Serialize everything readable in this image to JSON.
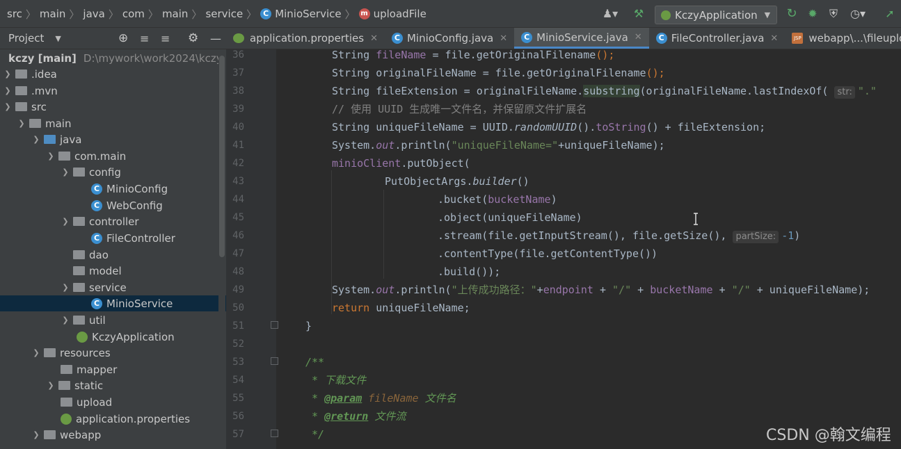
{
  "breadcrumb": {
    "items": [
      "src",
      "main",
      "java",
      "com",
      "main",
      "service"
    ],
    "class_name": "MinioService",
    "method_name": "uploadFile"
  },
  "toolbar": {
    "run_config": "KczyApplication"
  },
  "project_panel": {
    "title": "Project",
    "tree": [
      {
        "label": "kczy [main]",
        "extra": "D:\\mywork\\work2024\\kczy",
        "type": "module",
        "expanded": true
      },
      {
        "label": ".idea",
        "type": "folder",
        "expanded": false
      },
      {
        "label": ".mvn",
        "type": "folder",
        "expanded": false
      },
      {
        "label": "src",
        "type": "folder",
        "expanded": true
      },
      {
        "label": "main",
        "type": "folder",
        "expanded": true
      },
      {
        "label": "java",
        "type": "source-folder",
        "expanded": true
      },
      {
        "label": "com.main",
        "type": "package",
        "expanded": true
      },
      {
        "label": "config",
        "type": "package",
        "expanded": true
      },
      {
        "label": "MinioConfig",
        "type": "class"
      },
      {
        "label": "WebConfig",
        "type": "class"
      },
      {
        "label": "controller",
        "type": "package",
        "expanded": true
      },
      {
        "label": "FileController",
        "type": "class"
      },
      {
        "label": "dao",
        "type": "package"
      },
      {
        "label": "model",
        "type": "package"
      },
      {
        "label": "service",
        "type": "package",
        "expanded": true
      },
      {
        "label": "MinioService",
        "type": "class",
        "selected": true
      },
      {
        "label": "util",
        "type": "package",
        "expanded": false
      },
      {
        "label": "KczyApplication",
        "type": "spring-class"
      },
      {
        "label": "resources",
        "type": "resources-folder",
        "expanded": true
      },
      {
        "label": "mapper",
        "type": "folder"
      },
      {
        "label": "static",
        "type": "folder",
        "expanded": false
      },
      {
        "label": "upload",
        "type": "folder"
      },
      {
        "label": "application.properties",
        "type": "properties"
      },
      {
        "label": "webapp",
        "type": "web-folder",
        "expanded": true
      }
    ]
  },
  "tabs": [
    {
      "label": "application.properties",
      "icon": "properties-icon",
      "active": false
    },
    {
      "label": "MinioConfig.java",
      "icon": "class-icon",
      "active": false
    },
    {
      "label": "MinioService.java",
      "icon": "class-icon",
      "active": true
    },
    {
      "label": "FileController.java",
      "icon": "class-icon",
      "active": false
    },
    {
      "label": "webapp\\...\\fileupload.jsp",
      "icon": "jsp-icon",
      "active": false
    }
  ],
  "line_numbers": [
    "36",
    "37",
    "38",
    "39",
    "40",
    "41",
    "42",
    "43",
    "44",
    "45",
    "46",
    "47",
    "48",
    "49",
    "50",
    "51",
    "52",
    "53",
    "54",
    "55",
    "56",
    "57"
  ],
  "code": {
    "l36": {
      "type": "String ",
      "var": "fileName",
      "rest1": " = file.",
      "call": "getOriginalFilename",
      "rest2": "();"
    },
    "l37": {
      "type": "String originalFileName = file.",
      "call": "getOriginalFilename",
      "rest2": "();"
    },
    "l38": {
      "pre": "String fileExtension = originalFileName.",
      "call": "substring",
      "mid": "(originalFileName.",
      "call2": "lastIndexOf",
      "paren": "(",
      "hint": "str:",
      "lit": "\".\""
    },
    "l39": {
      "comment": "// 使用 UUID 生成唯一文件名，并保留原文件扩展名"
    },
    "l40": {
      "pre": "String uniqueFileName = UUID.",
      "call": "randomUUID",
      "mid": "().",
      "call2": "toString",
      "post": "() + fileExtension;"
    },
    "l41": {
      "pre": "System.",
      "out": "out",
      "mid": ".println(",
      "lit": "\"uniqueFileName=\"",
      "post": "+uniqueFileName);"
    },
    "l42": {
      "fld": "minioClient",
      "mid": ".putObject("
    },
    "l43": {
      "pre": "PutObjectArgs.",
      "call": "builder",
      "post": "()"
    },
    "l44": {
      "pre": ".bucket(",
      "fld": "bucketName",
      "post": ")"
    },
    "l45": {
      "pre": ".object(uniqueFileName)"
    },
    "l46": {
      "pre": ".stream(file.getInputStream(), file.getSize(), ",
      "hint": "partSize:",
      "num": "-1",
      "post": ")"
    },
    "l47": {
      "pre": ".contentType(file.getContentType())"
    },
    "l48": {
      "pre": ".build());"
    },
    "l49": {
      "pre": "System.",
      "out": "out",
      "mid": ".println(",
      "lit": "\"上传成功路径：\"",
      "plus1": "+",
      "fld1": "endpoint",
      "op1": " + ",
      "lit2": "\"/\"",
      "op2": " + ",
      "fld2": "bucketName",
      "op3": " + ",
      "lit3": "\"/\"",
      "post": " + uniqueFileName);"
    },
    "l50": {
      "kw": "return",
      "post": " uniqueFileName;"
    },
    "l51": {
      "pre": "}"
    },
    "l53": {
      "doc": "/**"
    },
    "l54": {
      "doc": " * 下载文件"
    },
    "l55": {
      "star": " * ",
      "tag": "@param",
      "name": " fileName",
      "desc": " 文件名"
    },
    "l56": {
      "star": " * ",
      "tag": "@return",
      "desc": " 文件流"
    },
    "l57": {
      "doc": " */"
    }
  },
  "watermark": "CSDN @翰文编程"
}
